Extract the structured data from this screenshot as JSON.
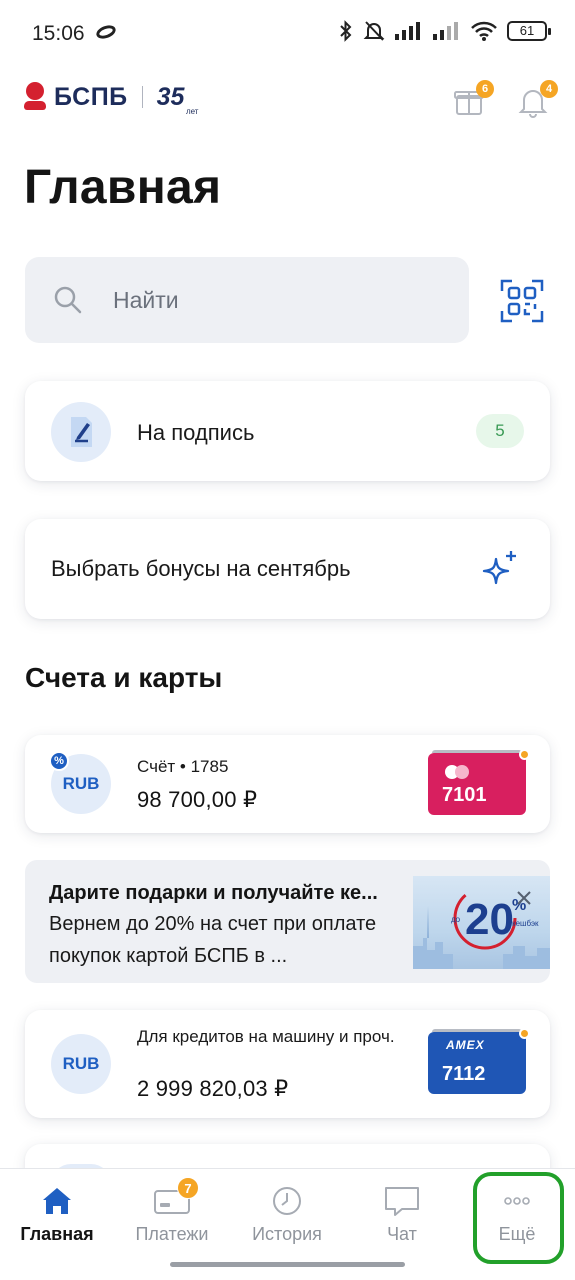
{
  "status_bar": {
    "time": "15:06",
    "battery": "61"
  },
  "header": {
    "logo_text": "БСПБ",
    "anniversary": "35",
    "anniversary_suffix": "лет",
    "gift_badge": "6",
    "bell_badge": "4"
  },
  "page_title": "Главная",
  "search": {
    "placeholder": "Найти"
  },
  "sign_card": {
    "label": "На подпись",
    "count": "5"
  },
  "bonus_card": {
    "label": "Выбрать бонусы на сентябрь"
  },
  "accounts_section": {
    "title": "Счета и карты",
    "accounts": [
      {
        "currency": "RUB",
        "subtitle": "Счёт • 1785",
        "amount": "98 700,00 ₽",
        "card_number": "7101",
        "card_color": "#d81f5f"
      },
      {
        "currency": "RUB",
        "subtitle": "Для кредитов на машину и проч.",
        "amount": "2 999 820,03 ₽",
        "card_brand": "AMEX",
        "card_number": "7112",
        "card_color": "#1f56b5"
      }
    ]
  },
  "promo": {
    "title": "Дарите подарки и получайте ке...",
    "text": "Вернем до 20% на счет при оплате покупок картой БСПБ в ...",
    "image_big": "20",
    "image_pct": "%",
    "image_small_left": "до",
    "image_small_right": "кешбэк"
  },
  "bottom_nav": {
    "items": [
      {
        "label": "Главная",
        "icon": "home-icon",
        "active": true
      },
      {
        "label": "Платежи",
        "icon": "payments-icon",
        "badge": "7"
      },
      {
        "label": "История",
        "icon": "history-icon"
      },
      {
        "label": "Чат",
        "icon": "chat-icon"
      },
      {
        "label": "Ещё",
        "icon": "more-icon"
      }
    ]
  },
  "colors": {
    "brand_red": "#d4202f",
    "brand_navy": "#1d2c5b",
    "accent_blue": "#1f5fc2",
    "badge_orange": "#f5a524",
    "highlight_green": "#22a02a"
  }
}
